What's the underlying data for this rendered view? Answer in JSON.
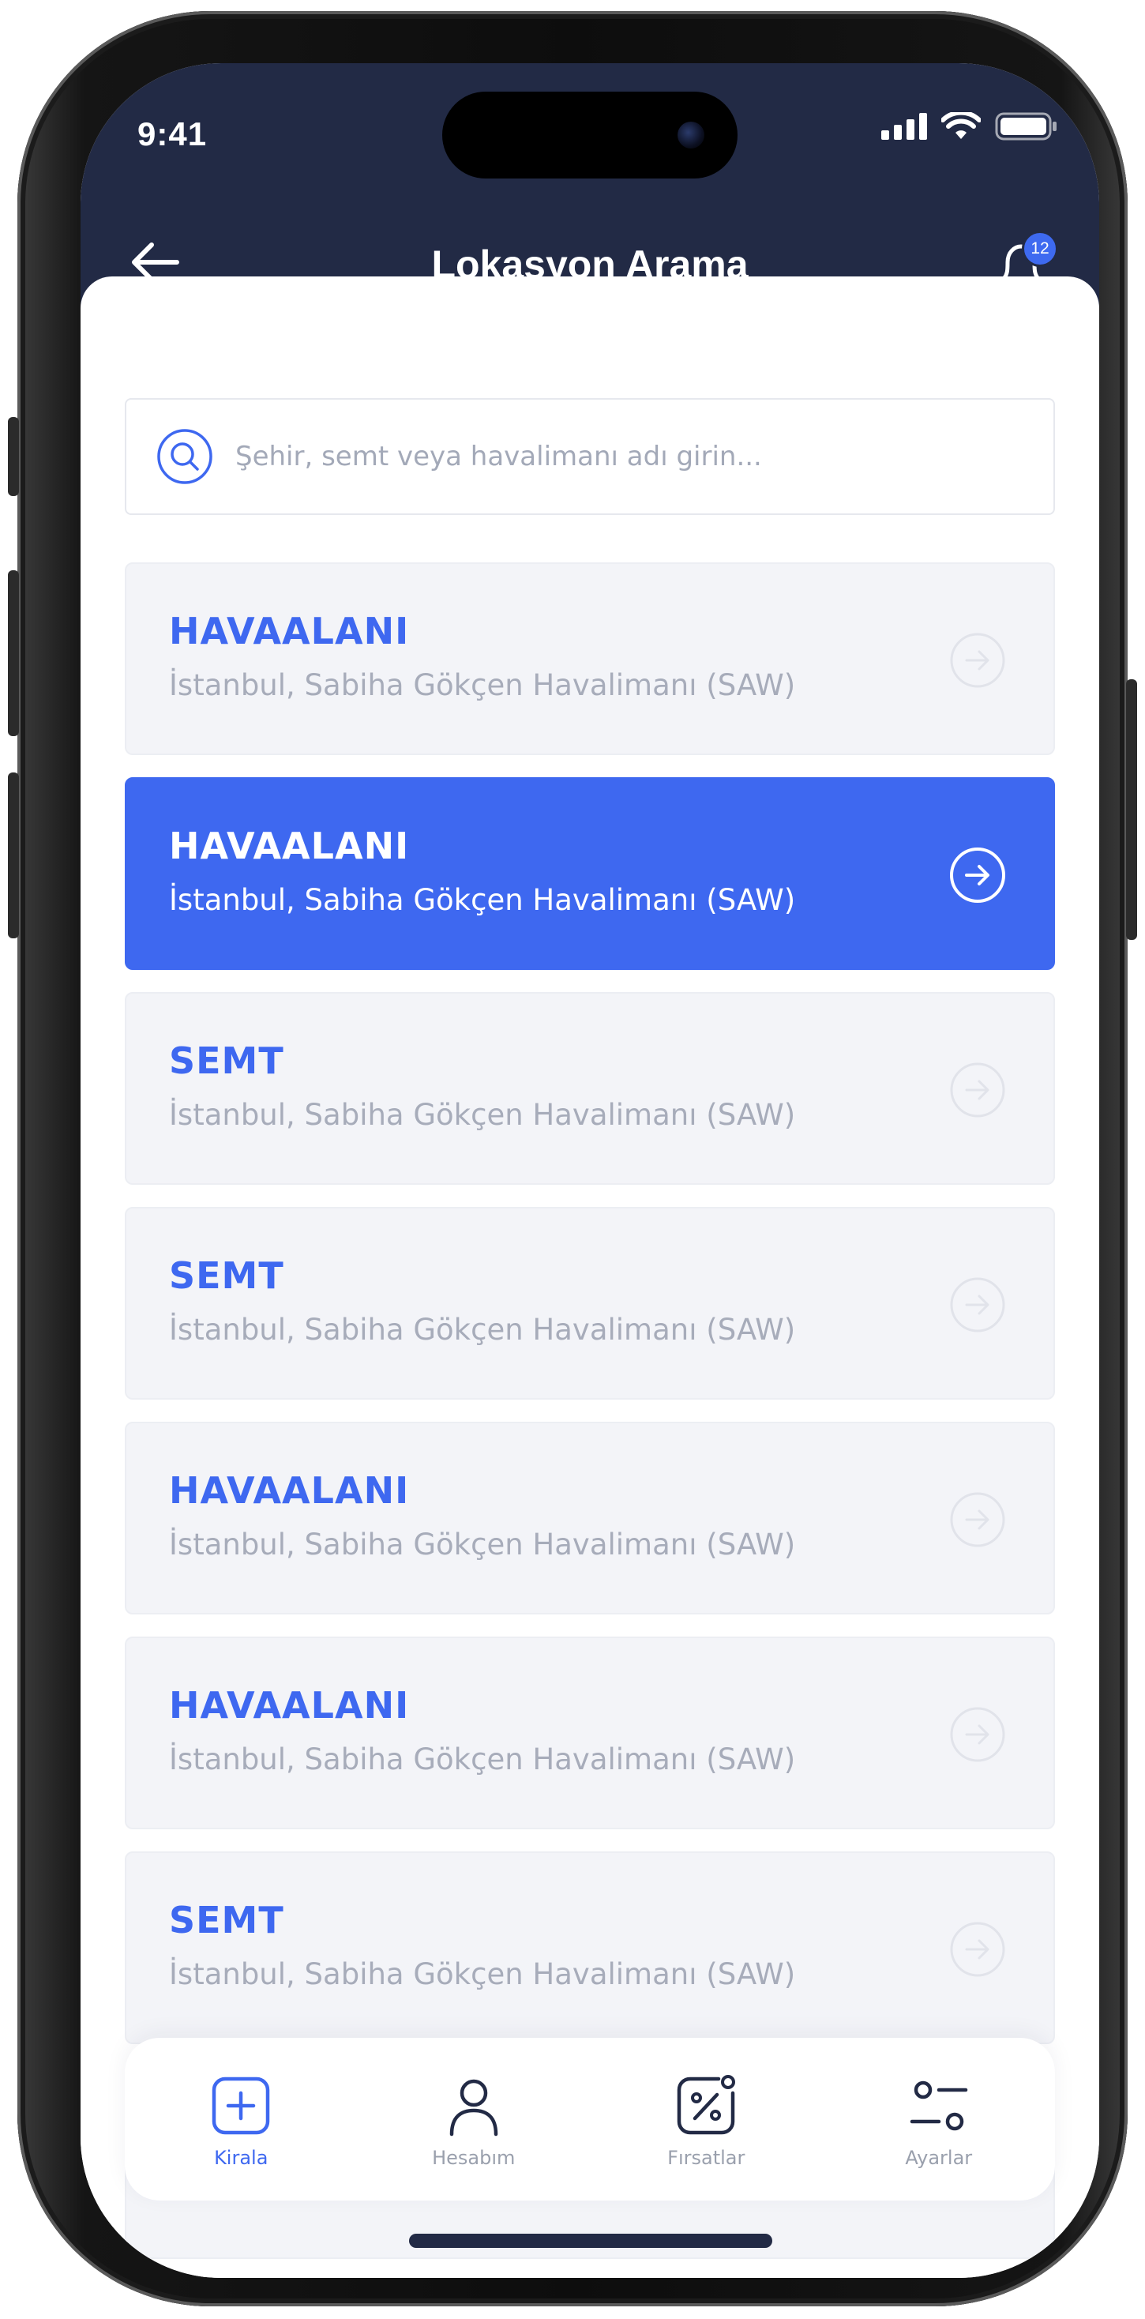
{
  "status_bar": {
    "time": "9:41"
  },
  "header": {
    "title": "Lokasyon Arama",
    "notification_count": "12"
  },
  "search": {
    "placeholder": "Şehir, semt veya havalimanı adı girin..."
  },
  "locations": [
    {
      "type": "HAVAALANI",
      "name": "İstanbul, Sabiha Gökçen Havalimanı (SAW)",
      "selected": false
    },
    {
      "type": "HAVAALANI",
      "name": "İstanbul, Sabiha Gökçen Havalimanı (SAW)",
      "selected": true
    },
    {
      "type": "SEMT",
      "name": "İstanbul, Sabiha Gökçen Havalimanı (SAW)",
      "selected": false
    },
    {
      "type": "SEMT",
      "name": "İstanbul, Sabiha Gökçen Havalimanı (SAW)",
      "selected": false
    },
    {
      "type": "HAVAALANI",
      "name": "İstanbul, Sabiha Gökçen Havalimanı (SAW)",
      "selected": false
    },
    {
      "type": "HAVAALANI",
      "name": "İstanbul, Sabiha Gökçen Havalimanı (SAW)",
      "selected": false
    },
    {
      "type": "SEMT",
      "name": "İstanbul, Sabiha Gökçen Havalimanı (SAW)",
      "selected": false
    }
  ],
  "tabbar": {
    "items": [
      {
        "label": "Kirala",
        "icon": "plus-square-icon",
        "active": true
      },
      {
        "label": "Hesabım",
        "icon": "user-icon",
        "active": false
      },
      {
        "label": "Fırsatlar",
        "icon": "percent-tag-icon",
        "active": false
      },
      {
        "label": "Ayarlar",
        "icon": "settings-toggle-icon",
        "active": false
      }
    ]
  },
  "colors": {
    "header_bg": "#222a45",
    "accent": "#3e68f0",
    "card_bg": "#f3f4f8",
    "muted_text": "#a7acba"
  }
}
